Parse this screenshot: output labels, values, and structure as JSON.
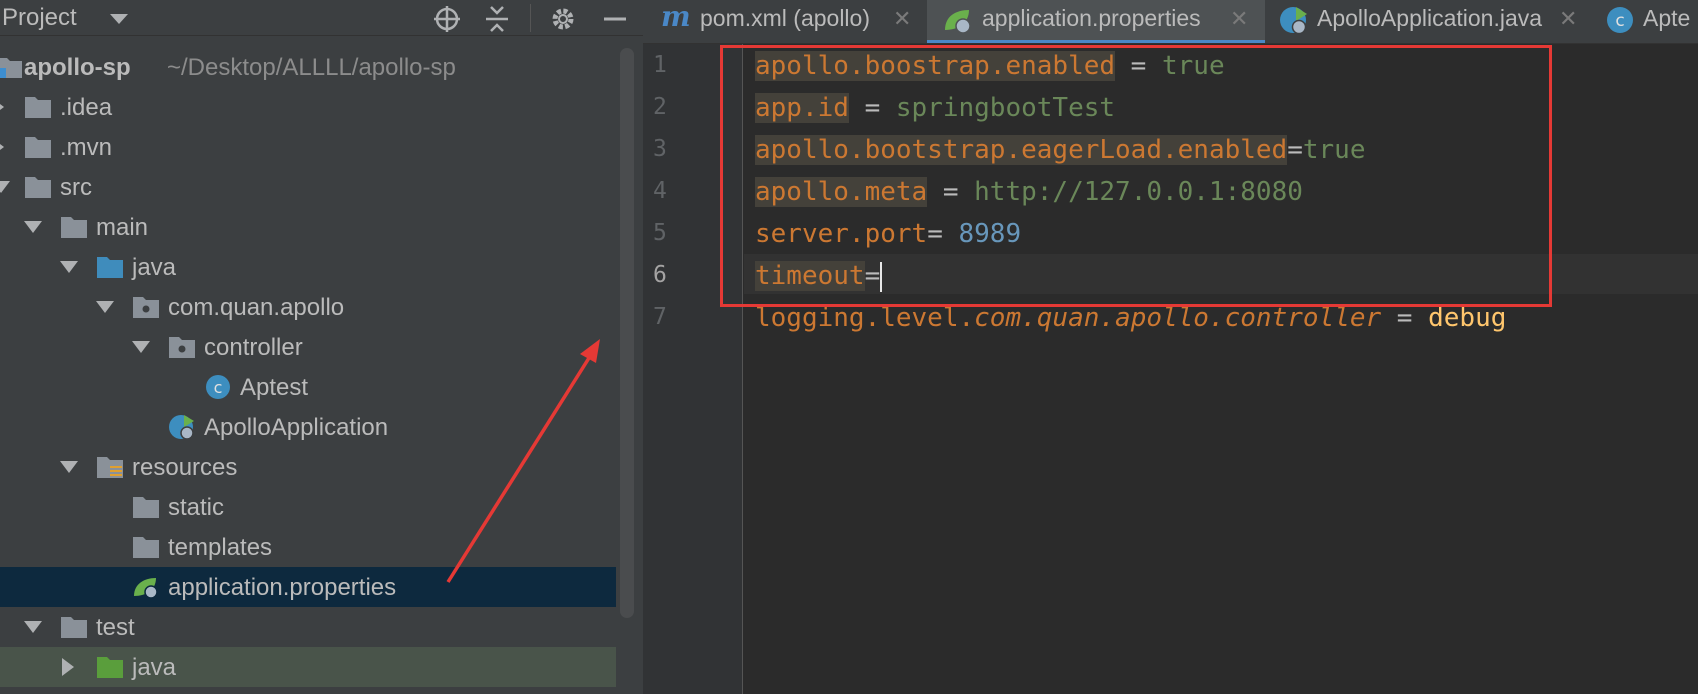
{
  "project_panel": {
    "title": "Project",
    "tree": [
      {
        "label": "apollo-sp",
        "path": "~/Desktop/ALLLL/apollo-sp",
        "icon": "module-folder-icon"
      },
      {
        "label": ".idea",
        "icon": "folder-icon"
      },
      {
        "label": ".mvn",
        "icon": "folder-icon"
      },
      {
        "label": "src",
        "icon": "folder-icon"
      },
      {
        "label": "main",
        "icon": "folder-icon"
      },
      {
        "label": "java",
        "icon": "source-folder-icon"
      },
      {
        "label": "com.quan.apollo",
        "icon": "package-icon"
      },
      {
        "label": "controller",
        "icon": "package-icon"
      },
      {
        "label": "Aptest",
        "icon": "class-icon"
      },
      {
        "label": "ApolloApplication",
        "icon": "spring-boot-class-icon"
      },
      {
        "label": "resources",
        "icon": "resources-folder-icon"
      },
      {
        "label": "static",
        "icon": "folder-icon"
      },
      {
        "label": "templates",
        "icon": "folder-icon"
      },
      {
        "label": "application.properties",
        "icon": "spring-properties-icon"
      },
      {
        "label": "test",
        "icon": "folder-icon"
      },
      {
        "label": "java",
        "icon": "test-source-folder-icon"
      }
    ]
  },
  "tabs": [
    {
      "label": "pom.xml (apollo)",
      "icon": "maven-icon"
    },
    {
      "label": "application.properties",
      "icon": "spring-properties-icon",
      "active": true
    },
    {
      "label": "ApolloApplication.java",
      "icon": "spring-boot-class-icon"
    },
    {
      "label": "Apte",
      "icon": "class-icon"
    }
  ],
  "editor": {
    "line_numbers": [
      "1",
      "2",
      "3",
      "4",
      "5",
      "6",
      "7"
    ],
    "current_line": 6,
    "lines": [
      {
        "key": "apollo.boostrap.enabled",
        "sep": " = ",
        "value": "true"
      },
      {
        "key": "app.id",
        "sep": " = ",
        "value": "springbootTest"
      },
      {
        "key": "apollo.bootstrap.eagerLoad.enabled",
        "sep": "=",
        "value": "true"
      },
      {
        "key": "apollo.meta",
        "sep": " = ",
        "value": "http://127.0.0.1:8080"
      },
      {
        "key": "server.port",
        "sep": "= ",
        "value": "8989"
      },
      {
        "key": "timeout",
        "sep": "=",
        "value": ""
      },
      {
        "key_prefix": "logging.level.",
        "key_italic": "com.quan.apollo.controller",
        "sep": " = ",
        "value": "debug"
      }
    ]
  },
  "colors": {
    "key": "#cc7832",
    "string_value": "#6a8759",
    "number_value": "#6897bb",
    "annotation": "#e53935",
    "selection": "#0d293e"
  }
}
